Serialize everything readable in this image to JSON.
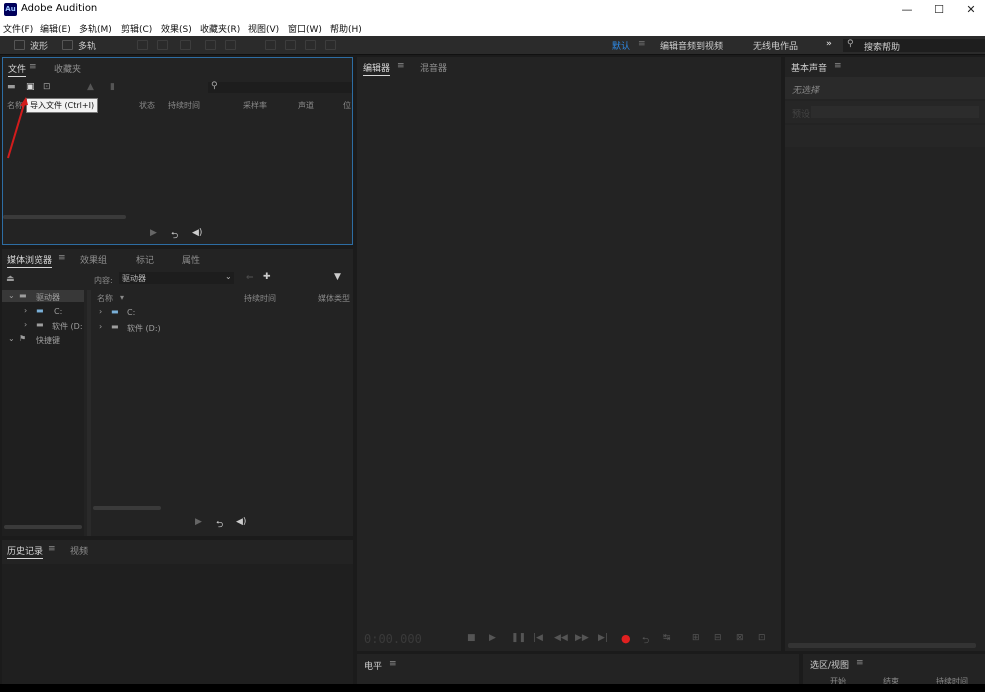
{
  "window": {
    "app_logo_text": "Au",
    "title": "Adobe Audition",
    "minimize": "—",
    "maximize": "☐",
    "close": "✕"
  },
  "menu": [
    "文件(F)",
    "编辑(E)",
    "多轨(M)",
    "剪辑(C)",
    "效果(S)",
    "收藏夹(R)",
    "视图(V)",
    "窗口(W)",
    "帮助(H)"
  ],
  "toolbar": {
    "waveform": "波形",
    "multitrack": "多轨",
    "workspace_default": "默认",
    "workspace_edit_video": "编辑音频到视频",
    "workspace_radio": "无线电作品",
    "more": "»",
    "search_help": "搜索帮助",
    "accent": "#2e8ae6"
  },
  "files_panel": {
    "tabs": [
      "文件",
      "收藏夹"
    ],
    "columns": [
      "名称",
      "状态",
      "持续时间",
      "采样率",
      "声道",
      "位"
    ],
    "tooltip": "导入文件 (Ctrl+I)",
    "search_icon": "search-icon",
    "border_color": "#2d6da3"
  },
  "media_panel": {
    "tabs": [
      "媒体浏览器",
      "效果组",
      "标记",
      "属性"
    ],
    "content_label": "内容:",
    "content_value": "驱动器",
    "tree": [
      "驱动器",
      "C:",
      "软件 (D:",
      "快捷键"
    ],
    "columns": [
      "名称",
      "持续时间",
      "媒体类型"
    ],
    "files": [
      "C:",
      "软件 (D:)"
    ]
  },
  "history_panel": {
    "tabs": [
      "历史记录",
      "视频"
    ]
  },
  "editor_panel": {
    "tabs": [
      "编辑器",
      "混音器"
    ],
    "time": "0:00.000",
    "record_color": "#e02020"
  },
  "essential_sound": {
    "title": "基本声音",
    "no_selection": "无选择",
    "preset": "预设:"
  },
  "levels_panel": {
    "title": "电平"
  },
  "selection_panel": {
    "title": "选区/视图",
    "columns": [
      "开始",
      "结束",
      "持续时间"
    ]
  }
}
